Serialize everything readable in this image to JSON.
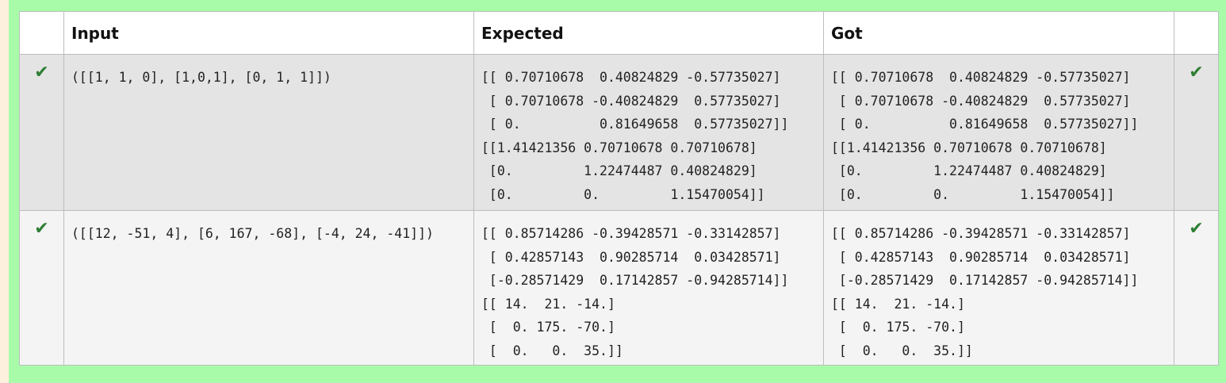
{
  "table": {
    "headers": {
      "status": "",
      "input": "Input",
      "expected": "Expected",
      "got": "Got",
      "result": ""
    },
    "rows": [
      {
        "status_icon": "check-icon",
        "input": "([[1, 1, 0], [1,0,1], [0, 1, 1]])",
        "expected": "[[ 0.70710678  0.40824829 -0.57735027]\n [ 0.70710678 -0.40824829  0.57735027]\n [ 0.          0.81649658  0.57735027]]\n[[1.41421356 0.70710678 0.70710678]\n [0.         1.22474487 0.40824829]\n [0.         0.         1.15470054]]",
        "got": "[[ 0.70710678  0.40824829 -0.57735027]\n [ 0.70710678 -0.40824829  0.57735027]\n [ 0.          0.81649658  0.57735027]]\n[[1.41421356 0.70710678 0.70710678]\n [0.         1.22474487 0.40824829]\n [0.         0.         1.15470054]]",
        "result_icon": "check-icon"
      },
      {
        "status_icon": "check-icon",
        "input": "([[12, -51, 4], [6, 167, -68], [-4, 24, -41]])",
        "expected": "[[ 0.85714286 -0.39428571 -0.33142857]\n [ 0.42857143  0.90285714  0.03428571]\n [-0.28571429  0.17142857 -0.94285714]]\n[[ 14.  21. -14.]\n [  0. 175. -70.]\n [  0.   0.  35.]]",
        "got": "[[ 0.85714286 -0.39428571 -0.33142857]\n [ 0.42857143  0.90285714  0.03428571]\n [-0.28571429  0.17142857 -0.94285714]]\n[[ 14.  21. -14.]\n [  0. 175. -70.]\n [  0.   0.  35.]]",
        "result_icon": "check-icon"
      }
    ]
  },
  "colors": {
    "pass_background": "#a8fba8",
    "check": "#2f7f35",
    "page_background": "#fdf0dc"
  }
}
